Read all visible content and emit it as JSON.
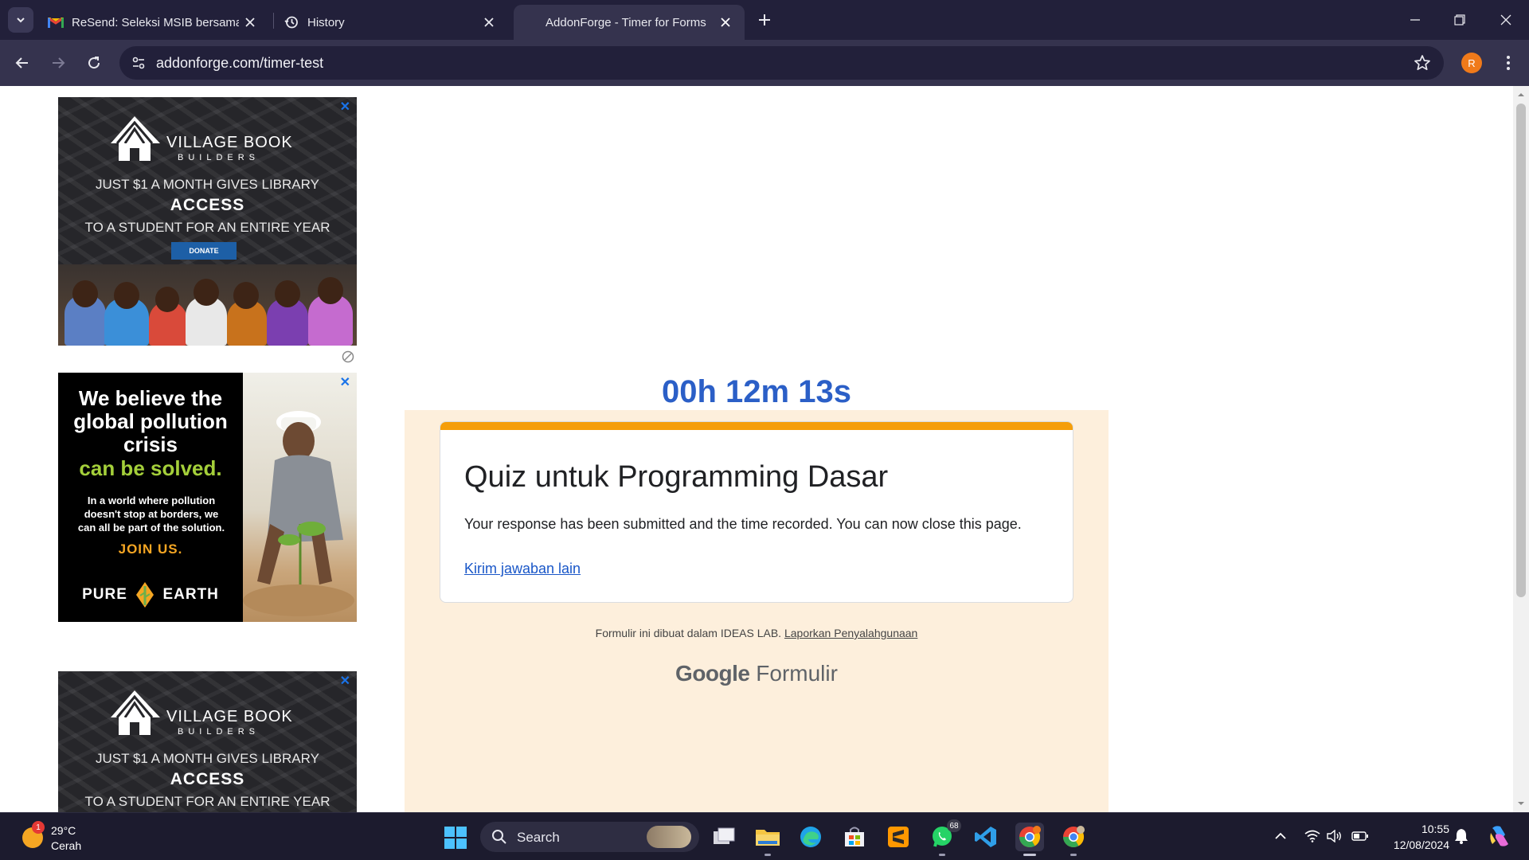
{
  "browser": {
    "tabs": [
      {
        "title": "ReSend: Seleksi MSIB bersama Sekolah",
        "icon": "gmail-icon"
      },
      {
        "title": "History",
        "icon": "history-icon"
      },
      {
        "title": "AddonForge - Timer for Forms",
        "icon": "none"
      }
    ],
    "new_tab_label": "+",
    "address": "addonforge.com/timer-test",
    "profile_initial": "R"
  },
  "ads": {
    "village": {
      "brand": "VILLAGE BOOK",
      "brand_sub": "BUILDERS",
      "line1": "JUST $1 A MONTH GIVES LIBRARY",
      "line2": "ACCESS",
      "line3": "TO A STUDENT FOR AN ENTIRE YEAR",
      "donate": "DONATE"
    },
    "pollution": {
      "headline": "We believe the global pollution crisis",
      "headline_green": "can be solved.",
      "body": "In a world where pollution doesn't stop at borders, we can all be part of the solution.",
      "cta": "JOIN US.",
      "brand_left": "PURE",
      "brand_right": "EARTH"
    },
    "close_label": "✕"
  },
  "page": {
    "timer": "00h 12m 13s",
    "form_title": "Quiz untuk Programming Dasar",
    "message": "Your response has been submitted and the time recorded. You can now close this page.",
    "link": "Kirim jawaban lain",
    "footer_text": "Formulir ini dibuat dalam IDEAS LAB.",
    "footer_link": "Laporkan Penyalahgunaan",
    "brand_google": "Google",
    "brand_product": "Formulir"
  },
  "taskbar": {
    "weather_temp": "29°C",
    "weather_cond": "Cerah",
    "weather_badge": "1",
    "search_label": "Search",
    "whatsapp_badge": "68",
    "time": "10:55",
    "date": "12/08/2024"
  },
  "colors": {
    "timer": "#2b5fc7",
    "form_accent": "#f59e0b",
    "form_background": "#fdefdc",
    "browser_frame": "#22203a"
  }
}
